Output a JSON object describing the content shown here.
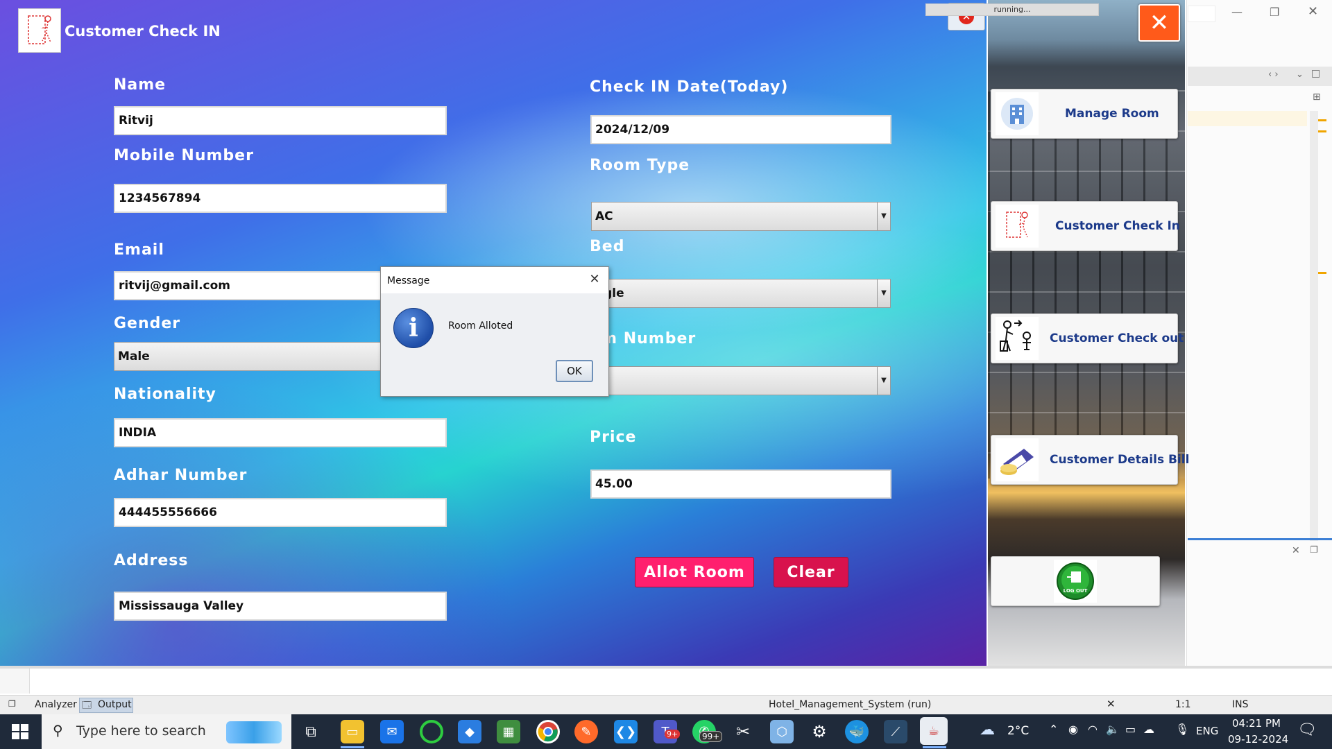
{
  "app": {
    "title": "Customer Check IN",
    "fields": {
      "name_label": "Name",
      "name_value": "Ritvij",
      "mobile_label": "Mobile Number",
      "mobile_value": "1234567894",
      "email_label": "Email",
      "email_value": "ritvij@gmail.com",
      "gender_label": "Gender",
      "gender_value": "Male",
      "nationality_label": "Nationality",
      "nationality_value": "INDIA",
      "adhar_label": "Adhar Number",
      "adhar_value": "444455556666",
      "address_label": "Address",
      "address_value": "Mississauga Valley",
      "checkin_label": "Check IN Date(Today)",
      "checkin_value": "2024/12/09",
      "roomtype_label": "Room Type",
      "roomtype_value": "AC",
      "bed_label": "Bed",
      "bed_value": "ngle",
      "roomnumber_label": "om Number",
      "roomnumber_value": "",
      "price_label": "Price",
      "price_value": "45.00"
    },
    "buttons": {
      "allot": "Allot Room",
      "clear": "Clear"
    },
    "colors": {
      "allot": "#ff1f6e",
      "clear": "#d8124d",
      "nav_text": "#1c3a8a"
    }
  },
  "sidebar": {
    "items": [
      {
        "label": "Manage Room",
        "icon": "building-icon"
      },
      {
        "label": "Customer Check In",
        "icon": "checkin-icon"
      },
      {
        "label": "Customer Check out",
        "icon": "checkout-icon"
      },
      {
        "label": "Customer Details Bill",
        "icon": "bill-icon"
      },
      {
        "label": "LOG OUT",
        "icon": "logout-icon"
      }
    ]
  },
  "dialog": {
    "title": "Message",
    "message": "Room Alloted",
    "ok": "OK"
  },
  "statusbar": {
    "analyzer": "Analyzer",
    "output": "Output",
    "project": "Hotel_Management_System (run)",
    "progress_text": "running...",
    "position": "1:1",
    "mode": "INS"
  },
  "taskbar": {
    "search_placeholder": "Type here to search",
    "weather": "2°C",
    "lang": "ENG",
    "time": "04:21 PM",
    "date": "09-12-2024",
    "badges": {
      "teams": "9+",
      "whatsapp": "99+"
    }
  }
}
